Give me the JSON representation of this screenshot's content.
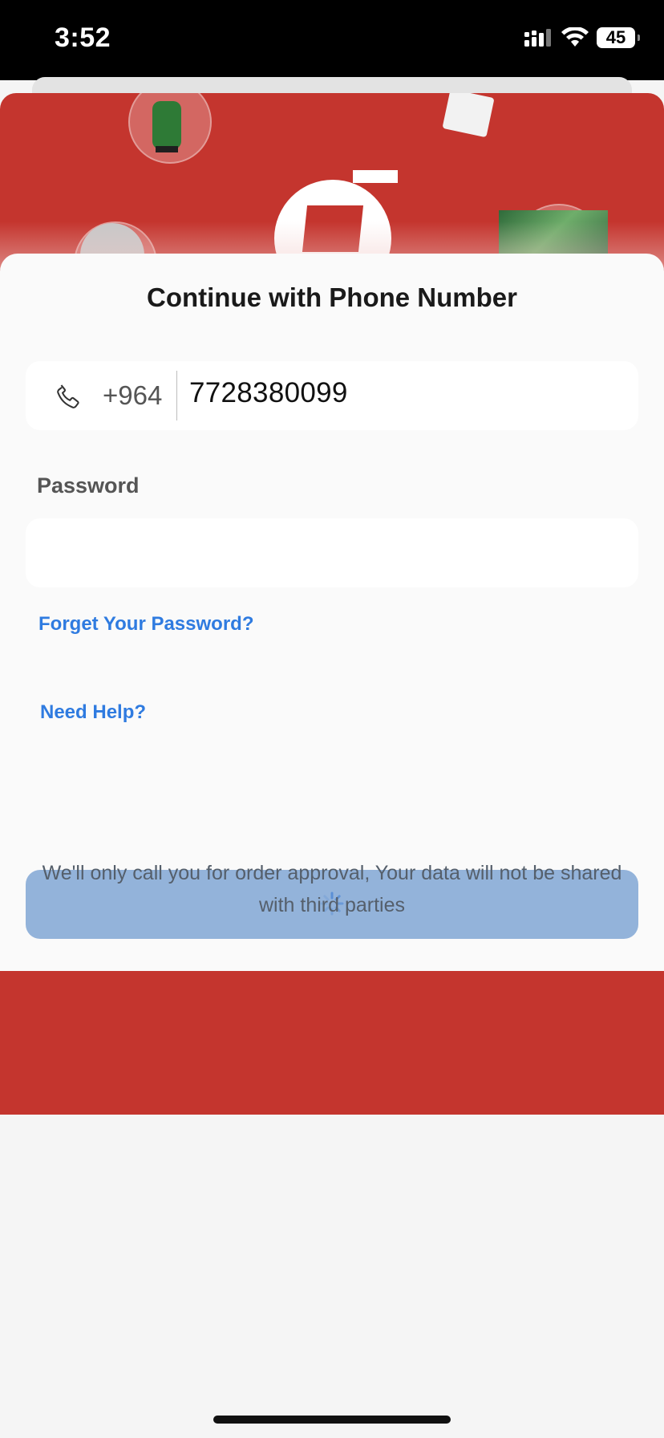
{
  "status_bar": {
    "time": "3:52",
    "battery": "45"
  },
  "sheet": {
    "title": "Continue with Phone Number",
    "phone": {
      "country_code": "+964",
      "value": "7728380099"
    },
    "password": {
      "label": "Password",
      "value": ""
    },
    "forgot_link": "Forget Your Password?",
    "help_link": "Need Help?",
    "disclaimer": "We'll only call you for order approval, Your data will not be shared with third parties"
  },
  "icons": {
    "phone": "phone-icon",
    "spinner": "loading-spinner-icon",
    "signal": "cellular-signal-icon",
    "wifi": "wifi-icon"
  },
  "colors": {
    "brand_red": "#c4352e",
    "link_blue": "#2f7be0",
    "button_loading": "#93b3da"
  }
}
